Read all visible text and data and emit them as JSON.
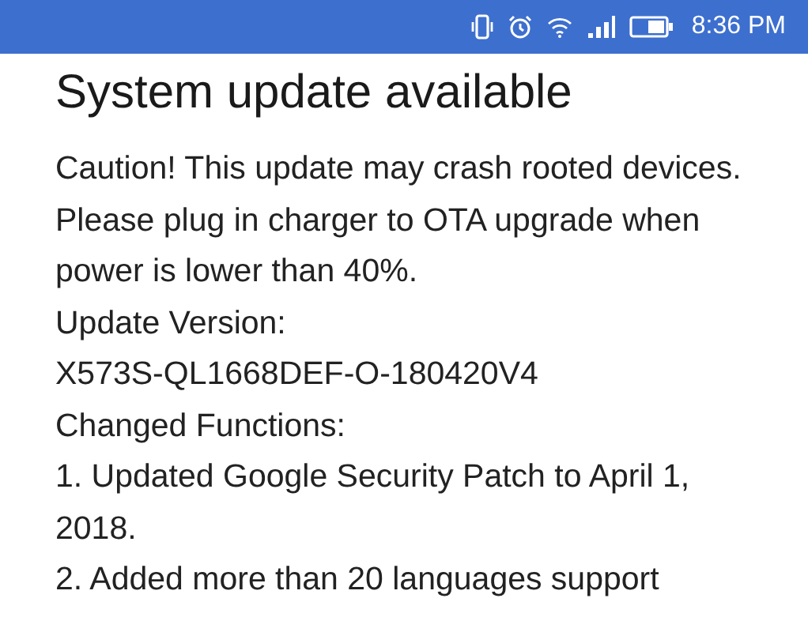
{
  "status_bar": {
    "time": "8:36 PM"
  },
  "title": "System update available",
  "paragraphs": [
    "Caution! This update may crash rooted devices.",
    "Please plug in charger to OTA upgrade when power is lower than 40%.",
    "Update Version:",
    "X573S-QL1668DEF-O-180420V4",
    "Changed Functions:",
    "1. Updated Google Security Patch to April 1, 2018.",
    "2. Added more than 20 languages support"
  ]
}
